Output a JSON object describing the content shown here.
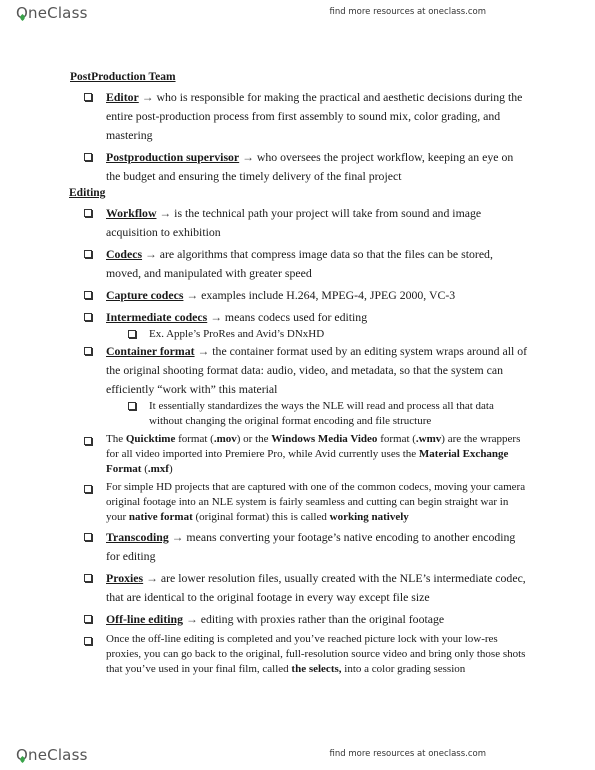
{
  "header": {
    "logo": "OneClass",
    "tagline": "find more resources at oneclass.com"
  },
  "footer": {
    "logo": "OneClass",
    "tagline": "find more resources at oneclass.com"
  },
  "sections": {
    "postproduction": {
      "heading": "PostProduction Team",
      "editor": {
        "term": "Editor",
        "arrow": "→",
        "text": " who is responsible for making the practical and aesthetic decisions during the entire post-production process from first assembly to sound mix, color grading, and mastering"
      },
      "supervisor": {
        "term": "Postproduction supervisor",
        "arrow": "→",
        "text": " who oversees the project workflow, keeping an eye on the budget and ensuring the timely delivery of the final project"
      }
    },
    "editing": {
      "heading": "Editing",
      "workflow": {
        "term": "Workflow",
        "arrow": "→",
        "text": " is the technical path your project will take from sound and image acquisition to exhibition"
      },
      "codecs": {
        "term": "Codecs",
        "arrow": "→",
        "text": " are algorithms that compress image data so that the files can be stored, moved, and manipulated with greater speed"
      },
      "capture": {
        "term": "Capture codecs",
        "arrow": "→",
        "text": " examples include H.264, MPEG-4, JPEG 2000, VC-3"
      },
      "intermediate": {
        "term": "Intermediate codecs",
        "arrow": "→",
        "text": " means codecs used for editing",
        "sub": "Ex. Apple’s ProRes and Avid’s DNxHD"
      },
      "container": {
        "term": "Container format",
        "arrow": "→",
        "text": " the container format used by an editing system wraps around all of the original shooting format data: audio, video, and metadata, so that the system can efficiently “work with” this material",
        "sub": "It essentially standardizes the ways the NLE will read and process all that data without changing the original format encoding and file structure"
      },
      "quicktime": {
        "t1": "The ",
        "b1": "Quicktime",
        "t2": " format (",
        "b2": ".mov",
        "t3": ") or the ",
        "b3": "Windows Media Video",
        "t4": " format (",
        "b4": ".wmv",
        "t5": ") are the wrappers for all video imported into Premiere Pro, while Avid currently uses the ",
        "b5": "Material Exchange Format",
        "t6": " (",
        "b6": ".mxf",
        "t7": ")"
      },
      "simplehd": {
        "t1": "For simple HD projects that are captured with one of the common codecs, moving your camera original footage into an NLE system is fairly seamless and cutting can begin straight war in your ",
        "b1": "native format",
        "t2": " (original format) this is called ",
        "b2": "working natively"
      },
      "transcoding": {
        "term": "Transcoding",
        "arrow": "→",
        "text": " means converting your footage’s native encoding to another encoding for editing"
      },
      "proxies": {
        "term": "Proxies",
        "arrow": "→",
        "text": " are lower resolution files, usually created with the NLE’s intermediate codec, that are identical to the original footage in every way except file size"
      },
      "offline": {
        "term": "Off-line editing",
        "arrow": "→",
        "text": " editing with proxies rather than the original footage"
      },
      "selects": {
        "t1": "Once the off-line editing is completed and you’ve reached picture lock with your low-res proxies, you can go back to the original, full-resolution source video and bring only those shots that you’ve used in your final film, called ",
        "b1": "the selects,",
        "t2": " into a color grading session"
      }
    }
  }
}
